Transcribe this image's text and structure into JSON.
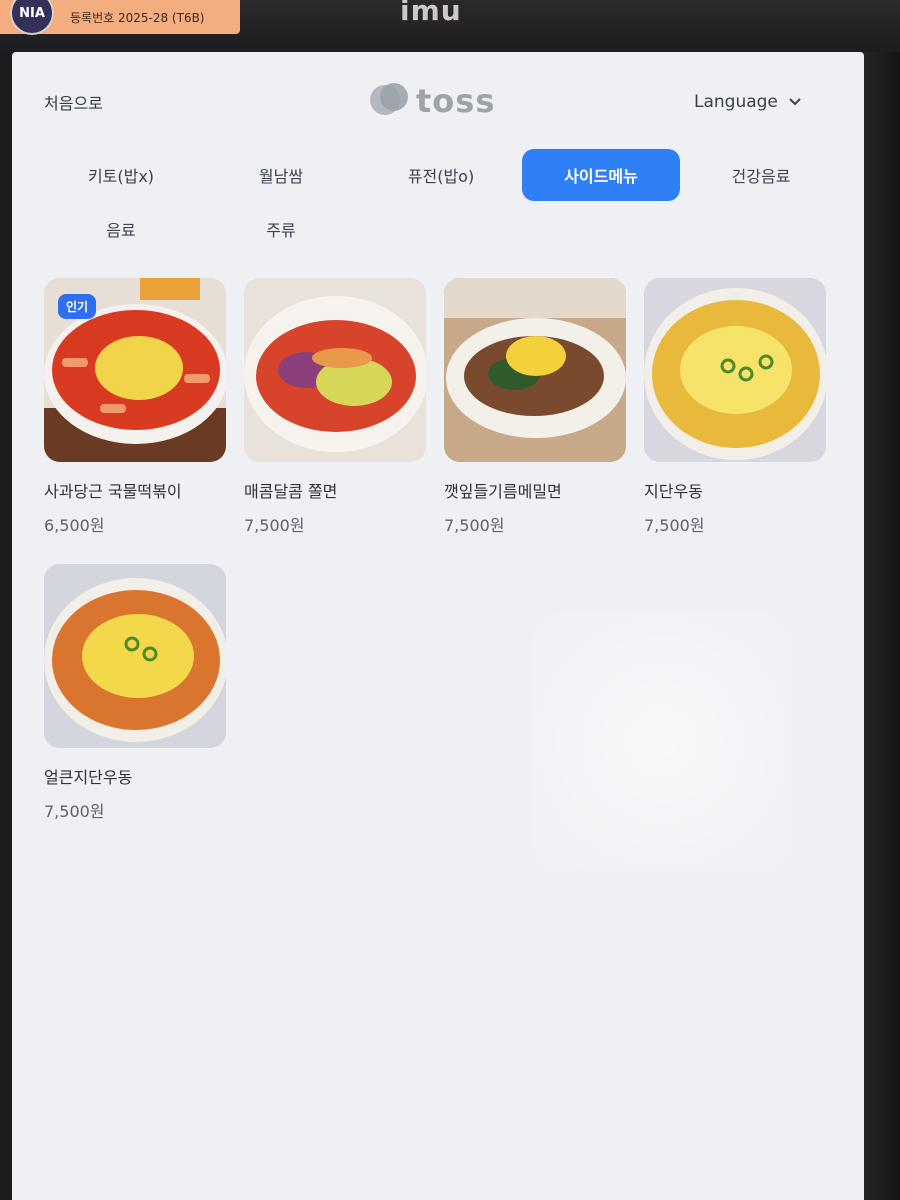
{
  "frame": {
    "nia_badge": "NIA",
    "registration": "등록번호 2025-28 (T6B)",
    "brand": "imu"
  },
  "header": {
    "home_label": "처음으로",
    "logo_text": "toss",
    "language_label": "Language"
  },
  "tabs": [
    {
      "label": "키토(밥x)",
      "active": false
    },
    {
      "label": "월남쌈",
      "active": false
    },
    {
      "label": "퓨전(밥o)",
      "active": false
    },
    {
      "label": "사이드메뉴",
      "active": true
    },
    {
      "label": "건강음료",
      "active": false
    },
    {
      "label": "음료",
      "active": false
    },
    {
      "label": "주류",
      "active": false
    }
  ],
  "items": [
    {
      "name": "사과당근 국물떡볶이",
      "price": "6,500원",
      "badge": "인기"
    },
    {
      "name": "매콤달콤 쫄면",
      "price": "7,500원"
    },
    {
      "name": "깻잎들기름메밀면",
      "price": "7,500원"
    },
    {
      "name": "지단우동",
      "price": "7,500원"
    },
    {
      "name": "얼큰지단우동",
      "price": "7,500원"
    }
  ],
  "colors": {
    "accent": "#2f80f7",
    "screen_bg": "#eef0f4",
    "badge": "#2d6ff0",
    "sticker": "#f4ad7f"
  }
}
